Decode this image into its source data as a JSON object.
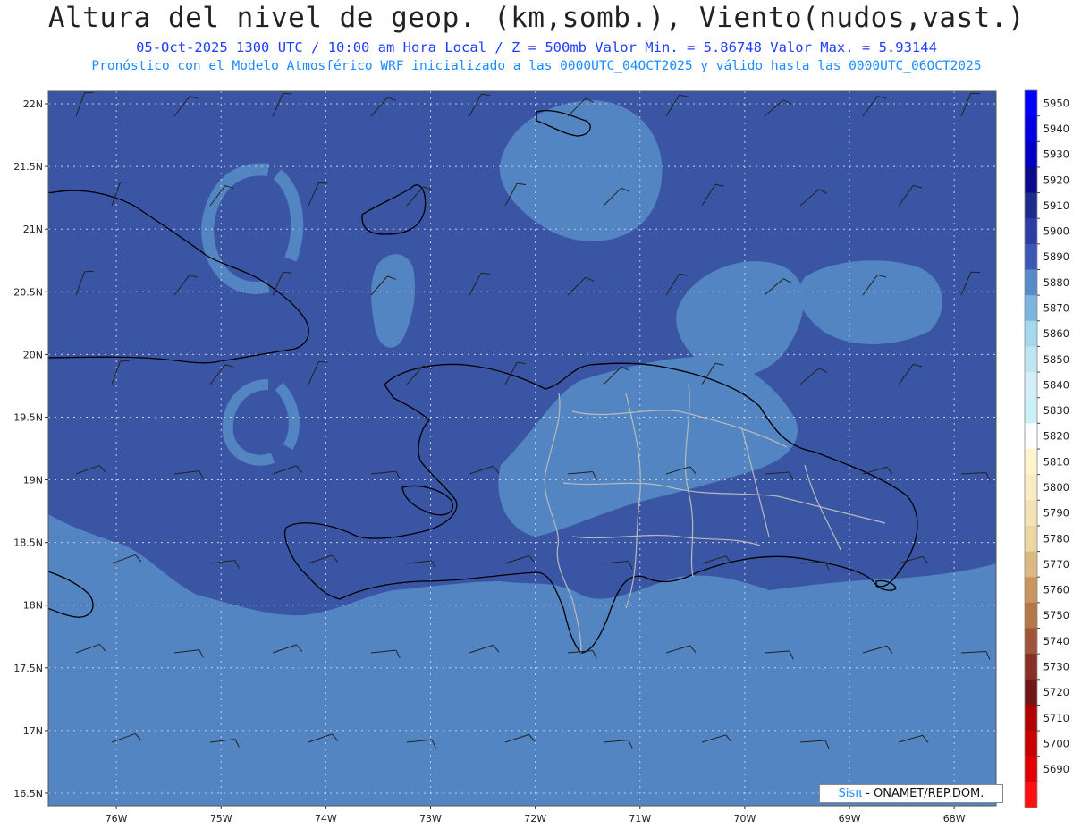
{
  "header": {
    "title": "Altura del nivel de geop. (km,somb.), Viento(nudos,vast.)",
    "subtitle_line1": "05-Oct-2025  1300 UTC / 10:00 am Hora Local / Z = 500mb   Valor Min. = 5.86748  Valor Max. = 5.93144",
    "subtitle_line2": "Pronóstico con el Modelo Atmosférico WRF inicializado a las 0000UTC_04OCT2025 y válido hasta las  0000UTC_06OCT2025"
  },
  "axes": {
    "lat_labels": [
      "22N",
      "21.5N",
      "21N",
      "20.5N",
      "20N",
      "19.5N",
      "19N",
      "18.5N",
      "18N",
      "17.5N",
      "17N",
      "16.5N"
    ],
    "lon_labels": [
      "76W",
      "75W",
      "74W",
      "73W",
      "72W",
      "71W",
      "70W",
      "69W",
      "68W"
    ],
    "lat_range": [
      16.4,
      22.1
    ],
    "lon_range": [
      -76.65,
      -67.6
    ],
    "grid": "dotted"
  },
  "colorbar": {
    "labels": [
      "5950",
      "5940",
      "5930",
      "5920",
      "5910",
      "5900",
      "5890",
      "5880",
      "5870",
      "5860",
      "5850",
      "5840",
      "5830",
      "5820",
      "5810",
      "5800",
      "5790",
      "5780",
      "5770",
      "5760",
      "5750",
      "5740",
      "5730",
      "5720",
      "5710",
      "5700",
      "5690"
    ],
    "colors": [
      "#0000ff",
      "#0000e0",
      "#0000c0",
      "#0a0a8c",
      "#1e2a8c",
      "#2c3ea6",
      "#3b58b4",
      "#5a8ac8",
      "#7db4de",
      "#a4d8ec",
      "#bde6f2",
      "#d4eef8",
      "#c8f2f6",
      "#ffffff",
      "#fff5cc",
      "#f8ecc0",
      "#f2e2b4",
      "#ecd6a4",
      "#dcb882",
      "#c8955e",
      "#b47848",
      "#a05538",
      "#883028",
      "#701818",
      "#b00000",
      "#c80000",
      "#e00000",
      "#ff1010"
    ]
  },
  "map_colors": {
    "high_shade": "#3b55a5",
    "low_shade": "#5385c2",
    "coast": "#000000",
    "borders": "#b9b9b9"
  },
  "credit": {
    "brand": "Sisπ",
    "text": " - ONAMET/REP.DOM."
  }
}
